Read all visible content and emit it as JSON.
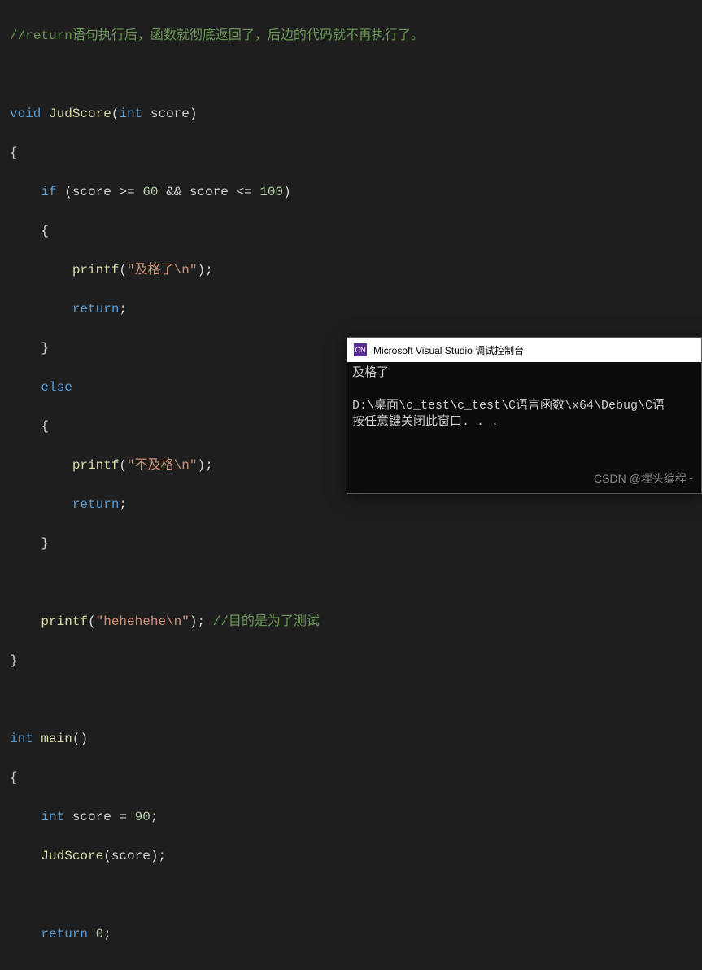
{
  "code": {
    "comment_top": "//return语句执行后，函数就彻底返回了，后边的代码就不再执行了。",
    "kw_void": "void",
    "fn_judscore": "JudScore",
    "lp": "(",
    "rp": ")",
    "kw_int": "int",
    "param_score": "score",
    "lbrace": "{",
    "rbrace": "}",
    "kw_if": "if",
    "cond": " (score >= 60 && score <= 100)",
    "id_score": "score",
    "op_ge": ">=",
    "num_60": "60",
    "op_and": "&&",
    "op_le": "<=",
    "num_100": "100",
    "fn_printf": "printf",
    "str_pass": "\"及格了\\n\"",
    "semi": ";",
    "kw_return": "return",
    "kw_else": "else",
    "str_fail": "\"不及格\\n\"",
    "str_hehe": "\"hehehehe\\n\"",
    "comment_test": " //目的是为了测试",
    "fn_main": "main",
    "num_90": "90",
    "op_eq": " = ",
    "num_0": "0",
    "sp": " "
  },
  "console": {
    "icon_text": "CN",
    "title": "Microsoft Visual Studio 调试控制台",
    "line1": "及格了",
    "line2": "",
    "line3": "D:\\桌面\\c_test\\c_test\\C语言函数\\x64\\Debug\\C语",
    "line4": "按任意键关闭此窗口. . ."
  },
  "watermark": "CSDN @埋头编程~"
}
